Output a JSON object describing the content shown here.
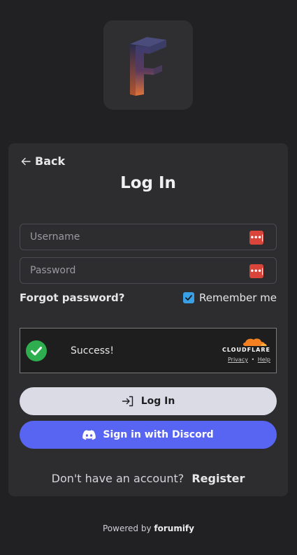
{
  "nav": {
    "back_label": "Back"
  },
  "form": {
    "title": "Log In",
    "username_placeholder": "Username",
    "password_placeholder": "Password",
    "forgot_label": "Forgot password?",
    "remember_label": "Remember me",
    "remember_checked": true
  },
  "captcha": {
    "status": "Success!",
    "provider": "CLOUDFLARE",
    "privacy_link": "Privacy",
    "separator": "•",
    "help_link": "Help"
  },
  "buttons": {
    "login_label": "Log In",
    "discord_label": "Sign in with Discord"
  },
  "register": {
    "prompt": "Don't have an account?",
    "link": "Register"
  },
  "footer": {
    "powered_prefix": "Powered by",
    "brand": "forumify"
  },
  "colors": {
    "background": "#212123",
    "card": "#2d2d30",
    "discord": "#5865f2",
    "login_button": "#dbdbe6",
    "success": "#2eae4e",
    "checkbox": "#3aa0e6"
  },
  "icons": [
    "app-logo",
    "back-arrow-icon",
    "password-manager-icon",
    "checkmark-icon",
    "cloudflare-logo",
    "login-icon",
    "discord-icon"
  ]
}
